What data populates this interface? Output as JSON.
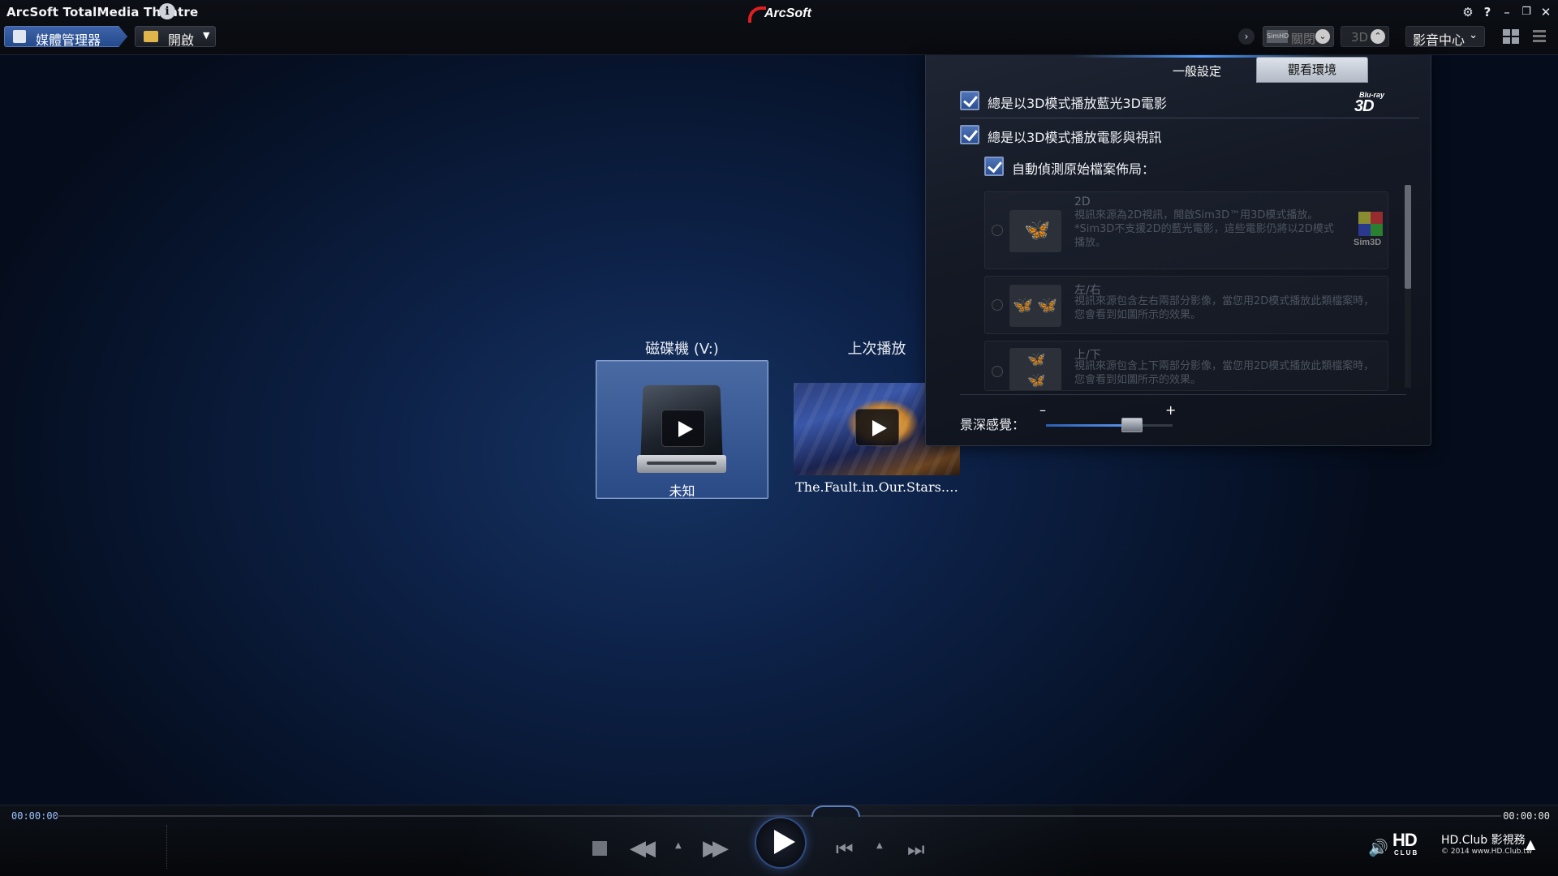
{
  "window": {
    "title": "ArcSoft TotalMedia Theatre",
    "brand": "ArcSoft",
    "icons": [
      "info-icon",
      "settings-gear-icon",
      "help-icon",
      "minimize-icon",
      "restore-icon",
      "close-icon"
    ]
  },
  "toolbar": {
    "media_manager": "媒體管理器",
    "open": "開啟",
    "open_arrow": "▼",
    "simhd_badge": "SimHD",
    "simhd_state": "關閉",
    "mode_3d": "3D",
    "media_center": "影音中心"
  },
  "tiles": {
    "drive": {
      "heading": "磁碟機 (V:)",
      "caption": "未知"
    },
    "recent": {
      "heading": "上次播放",
      "caption": "The.Fault.in.Our.Stars.…"
    }
  },
  "settings": {
    "tabs": {
      "general": "一般設定",
      "viewing": "觀看環境"
    },
    "bluray_logo": {
      "line1": "Blu-ray",
      "line2": "3D"
    },
    "options": {
      "always_3d_bluray": "總是以3D模式播放藍光3D電影",
      "always_3d_video": "總是以3D模式播放電影與視訊",
      "auto_detect_layout": "自動偵測原始檔案佈局："
    },
    "modes": [
      {
        "title": "2D",
        "desc": "視訊來源為2D視訊，開啟Sim3D™用3D模式播放。*Sim3D不支援2D的藍光電影，這些電影仍將以2D模式播放。"
      },
      {
        "title": "左/右",
        "desc": "視訊來源包含左右兩部分影像，當您用2D模式播放此類檔案時，您會看到如圖所示的效果。"
      },
      {
        "title": "上/下",
        "desc": "視訊來源包含上下兩部分影像，當您用2D模式播放此類檔案時，您會看到如圖所示的效果。"
      }
    ],
    "sim3d_logo": "Sim3D",
    "depth": {
      "label": "景深感覺：",
      "minus": "–",
      "plus": "+",
      "value_fraction": 0.68
    }
  },
  "playback": {
    "elapsed": "00:00:00",
    "total": "00:00:00"
  },
  "watermark": {
    "hd_logo": "HD",
    "hd_sub": "CLUB",
    "line1": "HD.Club 影視務",
    "line2": "© 2014 www.HD.Club.tw"
  }
}
